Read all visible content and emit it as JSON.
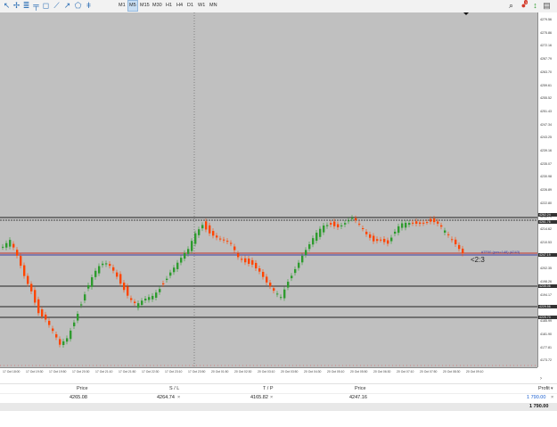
{
  "toolbar": {
    "tools": [
      "cursor-icon",
      "crosshair-icon",
      "period-separator-icon",
      "fibonacci-icon",
      "rectangle-icon",
      "trendline-icon",
      "arrow-icon",
      "shapes-icon",
      "vertical-line-icon"
    ],
    "timeframes": [
      "M1",
      "M5",
      "M15",
      "M30",
      "H1",
      "H4",
      "D1",
      "W1",
      "MN"
    ],
    "active_timeframe": "M5",
    "right_icons": [
      "search-icon",
      "notifications-icon",
      "one-click-trading-icon",
      "account-icon"
    ],
    "notification_count": "1"
  },
  "chart": {
    "background": "#c0c0c0",
    "bull_color": "#2e9b2e",
    "bear_color": "#ff4500",
    "ask_line_label": "#7F00 (pos=148) (4243)",
    "order_label": "<2:3"
  },
  "price_axis": {
    "labels": [
      "4279.56",
      "4275.86",
      "4272.16",
      "4267.79",
      "4263.70",
      "4259.61",
      "4255.52",
      "4251.43",
      "4247.34",
      "4243.25",
      "4239.16",
      "4235.07",
      "4230.98",
      "4226.89",
      "4222.80",
      "4218.71",
      "4214.62",
      "4210.53",
      "4206.44",
      "4202.35",
      "4198.26",
      "4194.17",
      "4190.08",
      "4185.99",
      "4181.90",
      "4177.81",
      "4173.72"
    ],
    "tags": [
      "4262.24",
      "4261.76",
      "4247.19",
      "4235.06",
      "4229.56",
      "4225.70"
    ]
  },
  "time_axis": {
    "labels": [
      "17 Oct 18:00",
      "17 Oct 19:30",
      "17 Oct 19:50",
      "17 Oct 20:30",
      "17 Oct 21:10",
      "17 Oct 21:50",
      "17 Oct 22:30",
      "17 Oct 23:10",
      "17 Oct 23:50",
      "20 Oct 01:50",
      "20 Oct 02:30",
      "20 Oct 03:10",
      "20 Oct 03:50",
      "20 Oct 04:30",
      "20 Oct 05:10",
      "20 Oct 05:50",
      "20 Oct 06:30",
      "20 Oct 07:10",
      "20 Oct 07:50",
      "20 Oct 08:30",
      "20 Oct 09:10"
    ]
  },
  "trade": {
    "headers": {
      "price": "Price",
      "sl": "S / L",
      "tp": "T / P",
      "price2": "Price",
      "profit": "Profit"
    },
    "row": {
      "price": "4265.08",
      "sl": "4264.74",
      "tp": "4165.82",
      "price2": "4247.16",
      "profit": "1 790.00"
    },
    "total": "1 790.00"
  }
}
